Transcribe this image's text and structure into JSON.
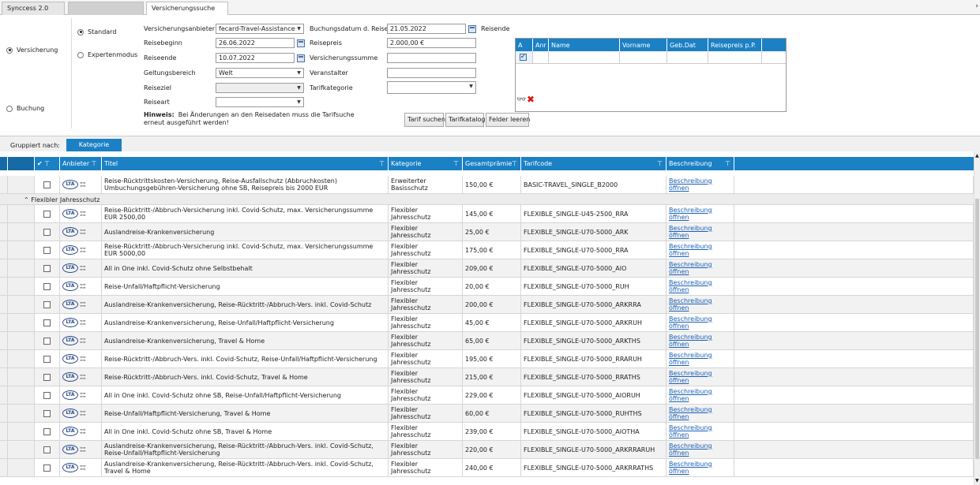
{
  "tabs": [
    {
      "label": "Synccess 2.0"
    },
    {
      "label": ""
    },
    {
      "label": "Versicherungssuche"
    }
  ],
  "form": {
    "mode_versicherung": "Versicherung",
    "mode_buchung": "Buchung",
    "search_standard": "Standard",
    "search_experten": "Expertenmodus",
    "labels": {
      "anbieter": "Versicherungsanbieter",
      "beginn": "Reisebeginn",
      "ende": "Reiseende",
      "geltung": "Geltungsbereich",
      "ziel": "Reiseziel",
      "art": "Reiseart",
      "buchungsdatum": "Buchungsdatum d. Reise",
      "preis": "Reisepreis",
      "summe": "Versicherungssumme",
      "veranstalter": "Veranstalter",
      "tarifkat": "Tarifkategorie",
      "reisende": "Reisende"
    },
    "values": {
      "anbieter": "fecard-Travel-Assistance",
      "beginn": "26.06.2022",
      "ende": "10.07.2022",
      "geltung": "Welt",
      "ziel": "",
      "art": "",
      "buchungsdatum": "21.05.2022",
      "preis": "2.000,00 €",
      "summe": "",
      "veranstalter": "",
      "tarifkat": ""
    },
    "hint_bold": "Hinweis:",
    "hint_text": "Bei Änderungen an den Reisedaten muss die Tarifsuche",
    "hint_text2": "erneut ausgeführt werden!",
    "btn_tarif_suchen": "Tarif suchen",
    "btn_tarifkatalog": "Tarifkatalog",
    "btn_felder_leeren": "Felder leeren"
  },
  "persons": {
    "headers": [
      "A",
      "Anr",
      "Name",
      "Vorname",
      "Geb.Dat",
      "Reisepreis p.P."
    ]
  },
  "grouping": {
    "label": "Gruppiert nach:",
    "chip": "Kategorie"
  },
  "grid": {
    "headers": {
      "check": "✔",
      "anbieter": "Anbieter",
      "titel": "Titel",
      "kategorie": "Kategorie",
      "praemie": "Gesamtprämie",
      "tarifcode": "Tarifcode",
      "beschreibung": "Beschreibung"
    },
    "group_flex": "Flexibler Jahresschutz",
    "link_text": "Beschreibung öffnen",
    "logo_text": "LTA",
    "rows_top": [
      {
        "titel": "Reise-Rücktrittskosten-Versicherung, Reise-Ausfallschutz (Abbruchkosten) Umbuchungsgebühren-Versicherung ohne SB, Reisepreis bis 2000 EUR",
        "kategorie": "Erweiterter Basisschutz",
        "praemie": "150,00 €",
        "tarifcode": "BASIC-TRAVEL_SINGLE_B2000"
      }
    ],
    "rows": [
      {
        "titel": "Reise-Rücktritt-/Abbruch-Versicherung inkl. Covid-Schutz, max. Versicherungssumme EUR 2500,00",
        "kategorie": "Flexibler Jahresschutz",
        "praemie": "145,00 €",
        "tarifcode": "FLEXIBLE_SINGLE-U45-2500_RRA"
      },
      {
        "titel": "Auslandreise-Krankenversicherung",
        "kategorie": "Flexibler Jahresschutz",
        "praemie": "25,00 €",
        "tarifcode": "FLEXIBLE_SINGLE-U70-5000_ARK"
      },
      {
        "titel": "Reise-Rücktritt-/Abbruch-Versicherung inkl. Covid-Schutz, max. Versicherungssumme EUR 5000,00",
        "kategorie": "Flexibler Jahresschutz",
        "praemie": "175,00 €",
        "tarifcode": "FLEXIBLE_SINGLE-U70-5000_RRA"
      },
      {
        "titel": "All in One inkl. Covid-Schutz ohne Selbstbehalt",
        "kategorie": "Flexibler Jahresschutz",
        "praemie": "209,00 €",
        "tarifcode": "FLEXIBLE_SINGLE-U70-5000_AIO"
      },
      {
        "titel": "Reise-Unfall/Haftpflicht-Versicherung",
        "kategorie": "Flexibler Jahresschutz",
        "praemie": "20,00 €",
        "tarifcode": "FLEXIBLE_SINGLE-U70-5000_RUH"
      },
      {
        "titel": "Auslandreise-Krankenversicherung, Reise-Rücktritt-/Abbruch-Vers. inkl. Covid-Schutz",
        "kategorie": "Flexibler Jahresschutz",
        "praemie": "200,00 €",
        "tarifcode": "FLEXIBLE_SINGLE-U70-5000_ARKRRA"
      },
      {
        "titel": "Auslandreise-Krankenversicherung, Reise-Unfall/Haftpflicht-Versicherung",
        "kategorie": "Flexibler Jahresschutz",
        "praemie": "45,00 €",
        "tarifcode": "FLEXIBLE_SINGLE-U70-5000_ARKRUH"
      },
      {
        "titel": "Auslandreise-Krankenversicherung, Travel & Home",
        "kategorie": "Flexibler Jahresschutz",
        "praemie": "65,00 €",
        "tarifcode": "FLEXIBLE_SINGLE-U70-5000_ARKTHS"
      },
      {
        "titel": "Reise-Rücktritt-/Abbruch-Vers. inkl. Covid-Schutz, Reise-Unfall/Haftpflicht-Versicherung",
        "kategorie": "Flexibler Jahresschutz",
        "praemie": "195,00 €",
        "tarifcode": "FLEXIBLE_SINGLE-U70-5000_RRARUH"
      },
      {
        "titel": "Reise-Rücktritt-/Abbruch-Vers. inkl. Covid-Schutz, Travel & Home",
        "kategorie": "Flexibler Jahresschutz",
        "praemie": "215,00 €",
        "tarifcode": "FLEXIBLE_SINGLE-U70-5000_RRATHS"
      },
      {
        "titel": "All in One inkl. Covid-Schutz ohne SB, Reise-Unfall/Haftpflicht-Versicherung",
        "kategorie": "Flexibler Jahresschutz",
        "praemie": "229,00 €",
        "tarifcode": "FLEXIBLE_SINGLE-U70-5000_AIORUH"
      },
      {
        "titel": "Reise-Unfall/Haftpflicht-Versicherung, Travel & Home",
        "kategorie": "Flexibler Jahresschutz",
        "praemie": "60,00 €",
        "tarifcode": "FLEXIBLE_SINGLE-U70-5000_RUHTHS"
      },
      {
        "titel": "All in One inkl. Covid-Schutz ohne SB, Travel & Home",
        "kategorie": "Flexibler Jahresschutz",
        "praemie": "239,00 €",
        "tarifcode": "FLEXIBLE_SINGLE-U70-5000_AIOTHA"
      },
      {
        "titel": "Auslandreise-Krankenversicherung, Reise-Rücktritt-/Abbruch-Vers. inkl. Covid-Schutz, Reise-Unfall/Haftpflicht-Versicherung",
        "kategorie": "Flexibler Jahresschutz",
        "praemie": "220,00 €",
        "tarifcode": "FLEXIBLE_SINGLE-U70-5000_ARKRRARUH"
      },
      {
        "titel": "Auslandreise-Krankenversicherung, Reise-Rücktritt-/Abbruch-Vers. inkl. Covid-Schutz, Travel & Home",
        "kategorie": "Flexibler Jahresschutz",
        "praemie": "240,00 €",
        "tarifcode": "FLEXIBLE_SINGLE-U70-5000_ARKRRATHS"
      }
    ]
  }
}
